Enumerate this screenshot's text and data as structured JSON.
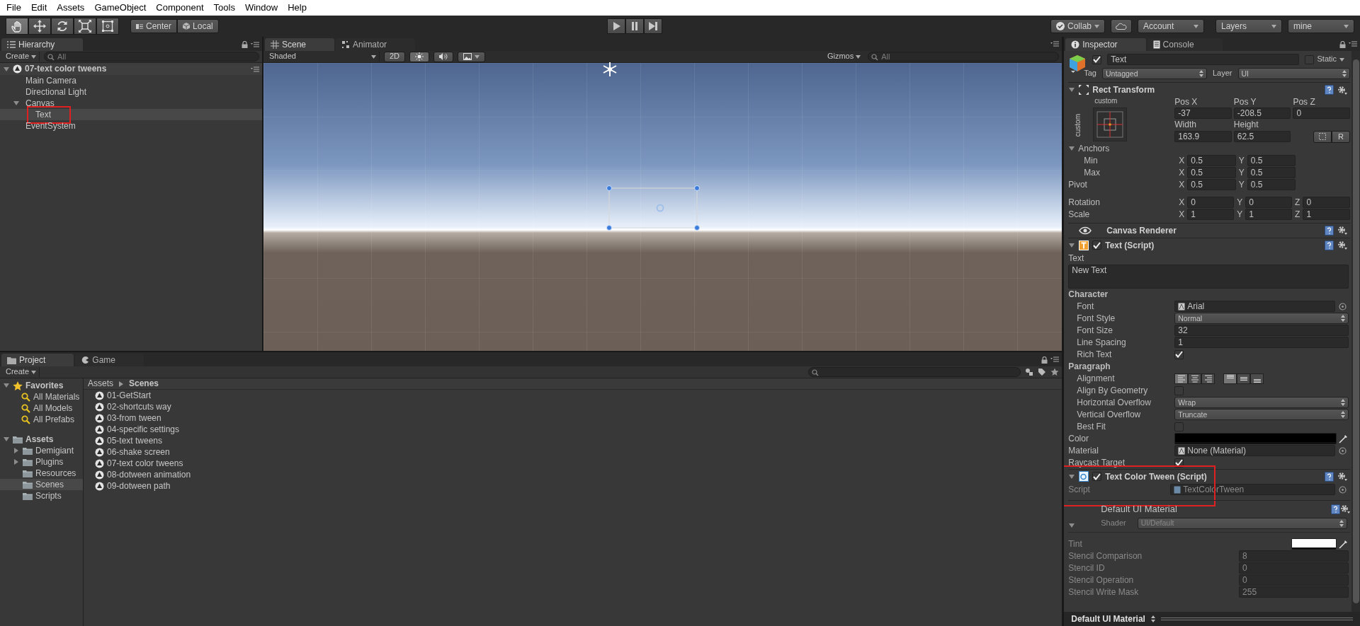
{
  "menu": [
    "File",
    "Edit",
    "Assets",
    "GameObject",
    "Component",
    "Tools",
    "Window",
    "Help"
  ],
  "toolbar": {
    "tools": [
      {
        "kind": "hand",
        "selected": true
      },
      {
        "kind": "move",
        "selected": false
      },
      {
        "kind": "rotate",
        "selected": false
      },
      {
        "kind": "scale",
        "selected": false
      },
      {
        "kind": "rect",
        "selected": false
      }
    ],
    "pivot_mode": "Center",
    "pivot_space": "Local",
    "playback": [
      {
        "kind": "play"
      },
      {
        "kind": "pause"
      },
      {
        "kind": "step"
      }
    ],
    "collab": "Collab",
    "account": "Account",
    "layers": "Layers",
    "layout": "mine"
  },
  "hierarchy": {
    "tab": "Hierarchy",
    "create": "Create",
    "search_placeholder": "All",
    "scene": "07-text color tweens",
    "items": [
      {
        "label": "Main Camera",
        "selected": false,
        "highlighted": false
      },
      {
        "label": "Directional Light",
        "selected": false,
        "highlighted": false
      },
      {
        "label": "Canvas",
        "selected": false,
        "highlighted": false,
        "expanded": true,
        "children": [
          {
            "label": "Text",
            "selected": true,
            "highlighted": true
          }
        ]
      },
      {
        "label": "EventSystem",
        "selected": false,
        "highlighted": false
      }
    ]
  },
  "scene": {
    "tabs": [
      {
        "label": "Scene",
        "selected": true,
        "kind": "scene"
      },
      {
        "label": "Animator",
        "selected": false,
        "kind": "animator"
      }
    ],
    "shading": "Shaded",
    "mode_2d": "2D",
    "lighting_on": true,
    "audio_on": false,
    "gizmos": "Gizmos",
    "search_placeholder": "All"
  },
  "project": {
    "tabs": [
      {
        "label": "Project",
        "selected": true,
        "kind": "project"
      },
      {
        "label": "Game",
        "selected": false,
        "kind": "game"
      }
    ],
    "create": "Create",
    "favorites": {
      "label": "Favorites",
      "items": [
        "All Materials",
        "All Models",
        "All Prefabs"
      ]
    },
    "assets": {
      "label": "Assets",
      "children": [
        {
          "label": "Demigiant",
          "collapsed_children": true,
          "selected": false
        },
        {
          "label": "Plugins",
          "collapsed_children": true,
          "selected": false
        },
        {
          "label": "Resources",
          "collapsed_children": false,
          "selected": false
        },
        {
          "label": "Scenes",
          "collapsed_children": false,
          "selected": true
        },
        {
          "label": "Scripts",
          "collapsed_children": false,
          "selected": false
        }
      ]
    },
    "breadcrumb": [
      "Assets",
      "Scenes"
    ],
    "files": [
      "01-GetStart",
      "02-shortcuts way",
      "03-from tween",
      "04-specific settings",
      "05-text tweens",
      "06-shake screen",
      "07-text color tweens",
      "08-dotween animation",
      "09-dotween path"
    ]
  },
  "inspector": {
    "tabs": [
      {
        "label": "Inspector",
        "selected": true,
        "kind": "info"
      },
      {
        "label": "Console",
        "selected": false,
        "kind": "console"
      }
    ],
    "object": {
      "active": true,
      "name": "Text",
      "static_label": "Static",
      "static": false,
      "tag_label": "Tag",
      "tag": "Untagged",
      "layer_label": "Layer",
      "layer": "UI"
    },
    "rect_transform": {
      "title": "Rect Transform",
      "preset_top": "custom",
      "preset_side": "custom",
      "pos_headers": [
        "Pos X",
        "Pos Y",
        "Pos Z"
      ],
      "pos_values": [
        "-37",
        "-208.5",
        "0"
      ],
      "size_headers": [
        "Width",
        "Height"
      ],
      "size_values": [
        "163.9",
        "62.5"
      ],
      "reset": "R",
      "anchors_label": "Anchors",
      "anchors_expanded": true,
      "rows": [
        {
          "kind": "sub",
          "label": "Min",
          "fields": [
            {
              "axis": "X",
              "value": "0.5"
            },
            {
              "axis": "Y",
              "value": "0.5"
            }
          ]
        },
        {
          "kind": "sub",
          "label": "Max",
          "fields": [
            {
              "axis": "X",
              "value": "0.5"
            },
            {
              "axis": "Y",
              "value": "0.5"
            }
          ]
        },
        {
          "kind": "main",
          "label": "Pivot",
          "fields": [
            {
              "axis": "X",
              "value": "0.5"
            },
            {
              "axis": "Y",
              "value": "0.5"
            }
          ]
        },
        {
          "kind": "spaced",
          "label": "Rotation",
          "fields": [
            {
              "axis": "X",
              "value": "0"
            },
            {
              "axis": "Y",
              "value": "0"
            },
            {
              "axis": "Z",
              "value": "0"
            }
          ]
        },
        {
          "kind": "main",
          "label": "Scale",
          "fields": [
            {
              "axis": "X",
              "value": "1"
            },
            {
              "axis": "Y",
              "value": "1"
            },
            {
              "axis": "Z",
              "value": "1"
            }
          ]
        }
      ]
    },
    "canvas_renderer": {
      "title": "Canvas Renderer"
    },
    "text_script": {
      "title": "Text (Script)",
      "enabled": true,
      "text_label": "Text",
      "text_value": "New Text",
      "sections": [
        {
          "title": "Character",
          "rows": [
            {
              "kind": "object",
              "label": "Font",
              "value": "Arial"
            },
            {
              "kind": "dropdown",
              "label": "Font Style",
              "value": "Normal"
            },
            {
              "kind": "input",
              "label": "Font Size",
              "value": "32"
            },
            {
              "kind": "input",
              "label": "Line Spacing",
              "value": "1"
            },
            {
              "kind": "checkbox",
              "label": "Rich Text",
              "checked": true
            }
          ]
        },
        {
          "title": "Paragraph",
          "rows": [
            {
              "kind": "alignment",
              "label": "Alignment",
              "horizontal": [
                {
                  "selected": true
                },
                {
                  "selected": false
                },
                {
                  "selected": false
                }
              ],
              "vertical": [
                {
                  "selected": true
                },
                {
                  "selected": false
                },
                {
                  "selected": false
                }
              ]
            },
            {
              "kind": "checkbox",
              "label": "Align By Geometry",
              "checked": false
            },
            {
              "kind": "dropdown",
              "label": "Horizontal Overflow",
              "value": "Wrap"
            },
            {
              "kind": "dropdown",
              "label": "Vertical Overflow",
              "value": "Truncate"
            },
            {
              "kind": "checkbox",
              "label": "Best Fit",
              "checked": false
            }
          ]
        }
      ],
      "rows": [
        {
          "kind": "color",
          "label": "Color",
          "color": "#000000"
        },
        {
          "kind": "object",
          "label": "Material",
          "value": "None (Material)"
        },
        {
          "kind": "checkbox",
          "label": "Raycast Target",
          "checked": true
        }
      ]
    },
    "tween_script": {
      "title": "Text Color Tween (Script)",
      "enabled": true,
      "highlighted": true,
      "script_label": "Script",
      "script": "TextColorTween"
    },
    "material": {
      "title": "Default UI Material",
      "shader_label": "Shader",
      "shader": "UI/Default",
      "rows": [
        {
          "kind": "color",
          "label": "Tint",
          "color": "#ffffff"
        },
        {
          "kind": "input",
          "label": "Stencil Comparison",
          "value": "8"
        },
        {
          "kind": "input",
          "label": "Stencil ID",
          "value": "0"
        },
        {
          "kind": "input",
          "label": "Stencil Operation",
          "value": "0"
        },
        {
          "kind": "input",
          "label": "Stencil Write Mask",
          "value": "255"
        }
      ]
    },
    "footer": "Default UI Material"
  }
}
